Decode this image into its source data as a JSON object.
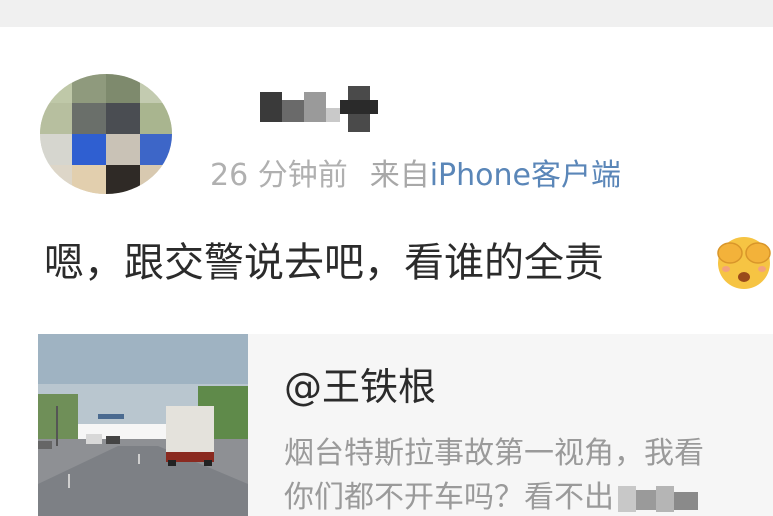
{
  "post": {
    "time_ago": "26 分钟前",
    "source_prefix": "来自",
    "source_device": "iPhone客户端",
    "text": "嗯，跟交警说去吧，看谁的全责",
    "emoji": "hands-over-eyes-emoji"
  },
  "repost": {
    "author": "@王铁根",
    "line1": "烟台特斯拉事故第一视角，我看",
    "line2": "你们都不开车吗？看不出"
  },
  "colors": {
    "link": "#5a86b8",
    "meta": "#a8a8a8",
    "text": "#2b2b2b",
    "card_bg": "#f6f6f6"
  }
}
